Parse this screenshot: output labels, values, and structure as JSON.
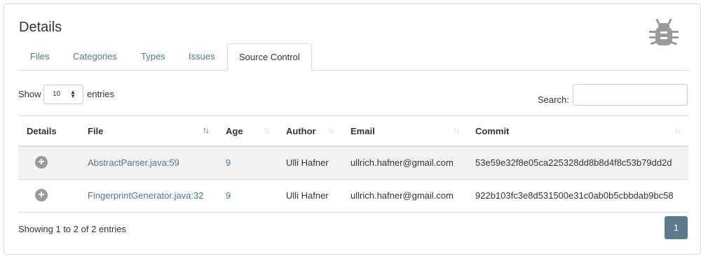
{
  "title": "Details",
  "tabs": [
    {
      "label": "Files"
    },
    {
      "label": "Categories"
    },
    {
      "label": "Types"
    },
    {
      "label": "Issues"
    },
    {
      "label": "Source Control"
    }
  ],
  "active_tab": "Source Control",
  "length_menu": {
    "show_label": "Show",
    "value": "10",
    "entries_label": "entries"
  },
  "search": {
    "label": "Search:",
    "value": ""
  },
  "table": {
    "headers": [
      "Details",
      "File",
      "Age",
      "Author",
      "Email",
      "Commit"
    ],
    "rows": [
      {
        "file": "AbstractParser.java:59",
        "age": "9",
        "author": "Ulli Hafner",
        "email": "ullrich.hafner@gmail.com",
        "commit": "53e59e32f8e05ca225328dd8b8d4f8c53b79dd2d"
      },
      {
        "file": "FingerprintGenerator.java:32",
        "age": "9",
        "author": "Ulli Hafner",
        "email": "ullrich.hafner@gmail.com",
        "commit": "922b103fc3e8d531500e31c0ab0b5cbbdab9bc58"
      }
    ]
  },
  "info": "Showing 1 to 2 of 2 entries",
  "pagination": {
    "current": "1"
  },
  "icons": {
    "header": "bug-icon",
    "expand": "plus-circle-icon"
  },
  "colors": {
    "link": "#4a7a95",
    "page_button": "#5b7b8c",
    "icon": "#9a9a9a"
  }
}
